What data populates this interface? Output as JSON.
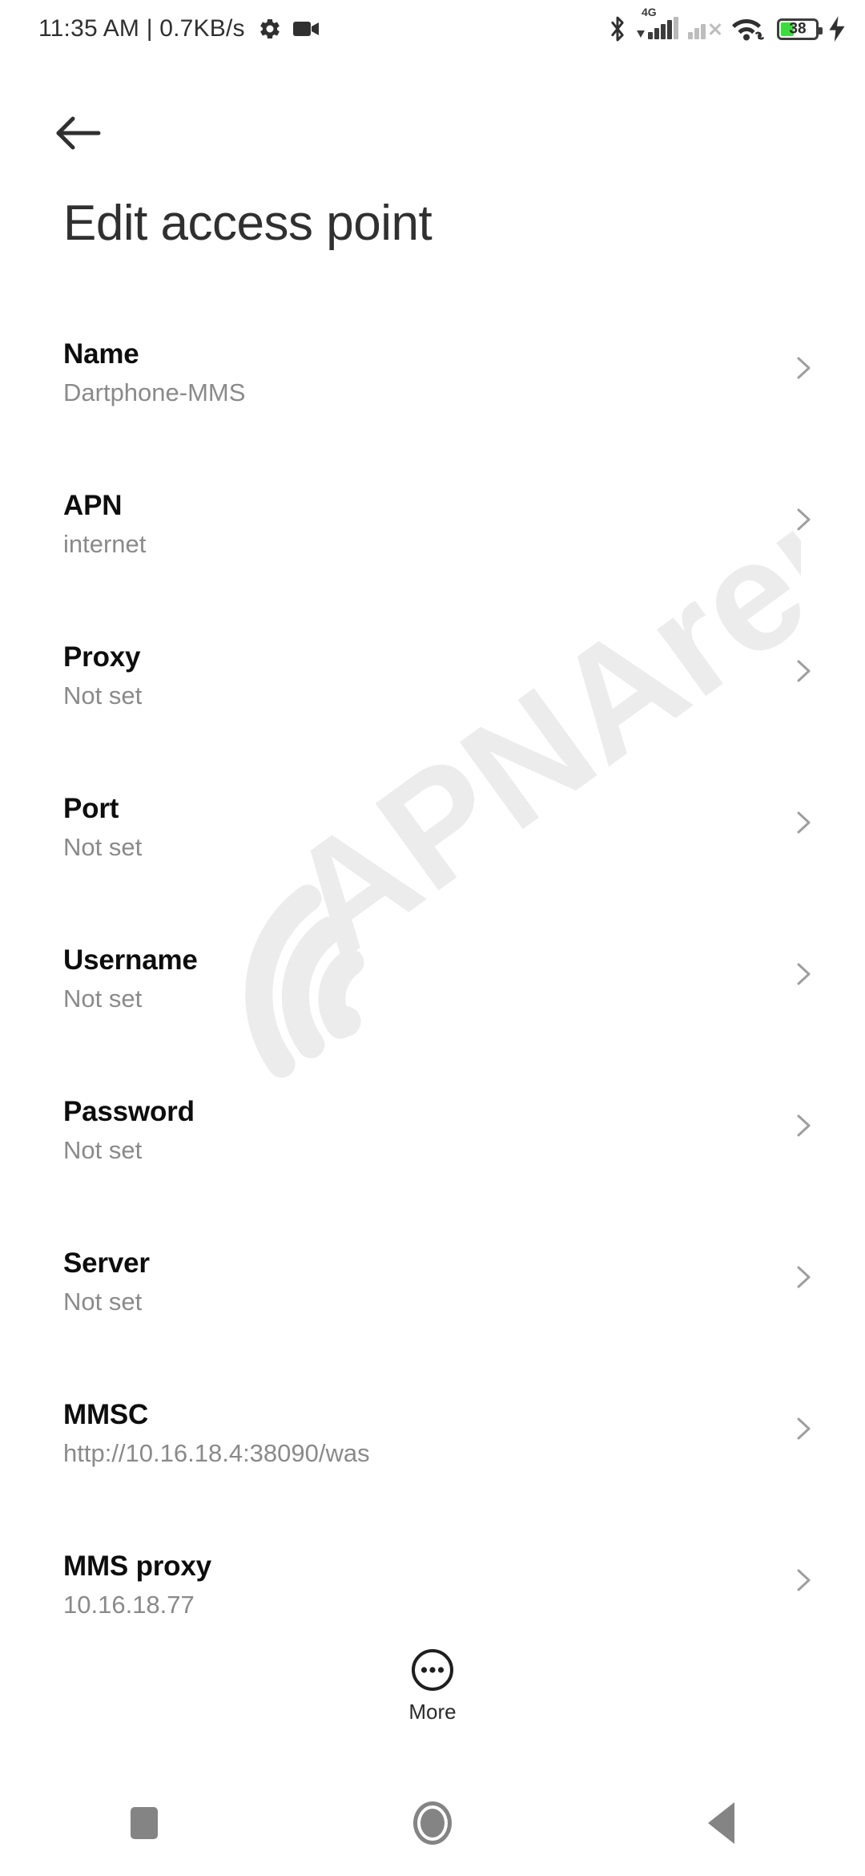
{
  "status_bar": {
    "clock": "11:35 AM",
    "separator": "|",
    "network_speed": "0.7KB/s",
    "icons": {
      "settings": "gear-icon",
      "screen_record": "video-camera-icon",
      "bluetooth": "bluetooth-icon",
      "sim1_network": "4G",
      "sim2": "sim-no-service-icon",
      "wifi": "wifi-icon",
      "vpn": "link-icon",
      "charging": "charging-bolt-icon"
    },
    "battery": {
      "percent": "38",
      "level": 38,
      "fill_color": "#3ddc3d"
    }
  },
  "header": {
    "back": "back-arrow",
    "title": "Edit access point"
  },
  "settings_list": [
    {
      "title": "Name",
      "value": "Dartphone-MMS"
    },
    {
      "title": "APN",
      "value": "internet"
    },
    {
      "title": "Proxy",
      "value": "Not set"
    },
    {
      "title": "Port",
      "value": "Not set"
    },
    {
      "title": "Username",
      "value": "Not set"
    },
    {
      "title": "Password",
      "value": "Not set"
    },
    {
      "title": "Server",
      "value": "Not set"
    },
    {
      "title": "MMSC",
      "value": "http://10.16.18.4:38090/was"
    },
    {
      "title": "MMS proxy",
      "value": "10.16.18.77"
    }
  ],
  "more_button": {
    "label": "More",
    "icon": "more-circle-icon"
  },
  "navigation_bar": {
    "recents": "recents-square-icon",
    "home": "home-circle-icon",
    "back": "back-triangle-icon"
  },
  "watermark": {
    "text": "APNArena",
    "color": "#ececec"
  },
  "theme": {
    "background": "#ffffff",
    "title_color": "#303030",
    "row_title_color": "#0d0d0d",
    "row_value_color": "#8a8a8a",
    "chevron_color": "#9e9e9e",
    "nav_icon_color": "#848484"
  }
}
